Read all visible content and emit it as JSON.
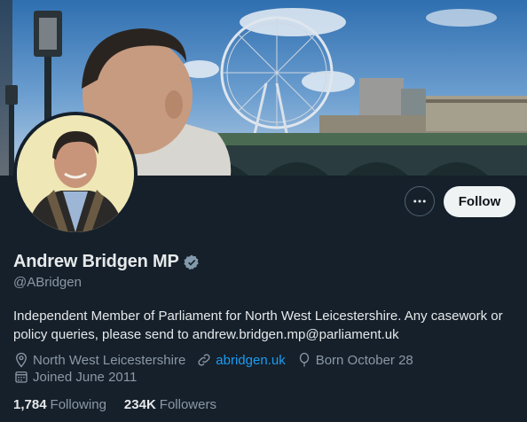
{
  "profile": {
    "display_name": "Andrew Bridgen MP",
    "handle": "@ABridgen",
    "bio": "Independent Member of Parliament for North West Leicestershire. Any casework or policy queries, please send to andrew.bridgen.mp@parliament.uk",
    "location": "North West Leicestershire",
    "website": "abridgen.uk",
    "birthday": "Born October 28",
    "joined": "Joined June 2011",
    "verified": true
  },
  "stats": {
    "following_count": "1,784",
    "following_label": "Following",
    "followers_count": "234K",
    "followers_label": "Followers"
  },
  "actions": {
    "follow_label": "Follow",
    "more_icon": "more-horizontal-icon"
  },
  "colors": {
    "background": "#15202b",
    "accent": "#1d9bf0",
    "secondary_text": "#8b98a5",
    "primary_text": "#e7e9ea",
    "follow_bg": "#eff3f4"
  },
  "icons": {
    "verified": "verified-badge-icon",
    "location": "location-pin-icon",
    "link": "link-icon",
    "birthday": "balloon-icon",
    "calendar": "calendar-icon"
  }
}
